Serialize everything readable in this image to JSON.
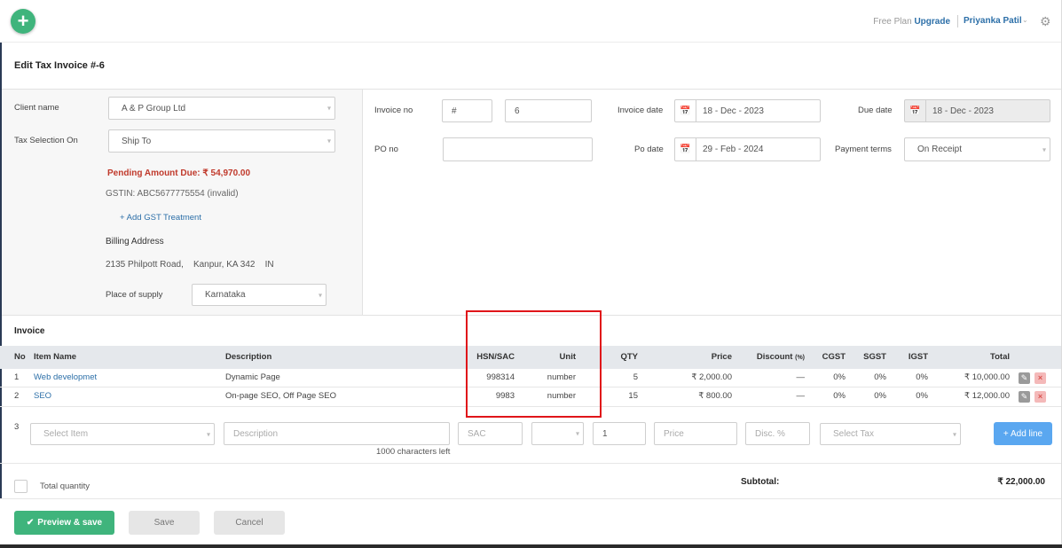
{
  "header": {
    "free_plan": "Free Plan",
    "upgrade": "Upgrade",
    "user_name": "Priyanka Patil"
  },
  "page_title": "Edit Tax Invoice #-6",
  "client": {
    "client_name_label": "Client name",
    "client_name_value": "A & P Group Ltd",
    "tax_selection_label": "Tax Selection On",
    "tax_selection_value": "Ship To",
    "pending_amount": "Pending Amount Due: ₹ 54,970.00",
    "gstin": "GSTIN: ABC5677775554 (invalid)",
    "add_gst": "Add GST Treatment",
    "billing_heading": "Billing Address",
    "billing_address": "2135 Philpott Road,    Kanpur, KA 342    IN",
    "place_of_supply_label": "Place of supply",
    "place_of_supply_value": "Karnataka"
  },
  "invoice_meta": {
    "invoice_no_label": "Invoice no",
    "invoice_prefix": "#",
    "invoice_no": "6",
    "invoice_date_label": "Invoice date",
    "invoice_date": "18 - Dec - 2023",
    "due_date_label": "Due date",
    "due_date": "18 - Dec - 2023",
    "po_no_label": "PO no",
    "po_no": "",
    "po_date_label": "Po date",
    "po_date": "29 - Feb - 2024",
    "payment_terms_label": "Payment terms",
    "payment_terms": "On Receipt"
  },
  "items_section": {
    "heading": "Invoice",
    "columns": {
      "no": "No",
      "item_name": "Item Name",
      "description": "Description",
      "hsn": "HSN/SAC",
      "unit": "Unit",
      "qty": "QTY",
      "price": "Price",
      "discount": "Discount",
      "discount_unit": "(%)",
      "cgst": "CGST",
      "sgst": "SGST",
      "igst": "IGST",
      "total": "Total"
    },
    "rows": [
      {
        "no": "1",
        "item_name": "Web developmet",
        "description": "Dynamic Page",
        "hsn": "998314",
        "unit": "number",
        "qty": "5",
        "price": "₹ 2,000.00",
        "discount": "—",
        "cgst": "0%",
        "sgst": "0%",
        "igst": "0%",
        "total": "₹ 10,000.00"
      },
      {
        "no": "2",
        "item_name": "SEO",
        "description": "On-page SEO, Off Page SEO",
        "hsn": "9983",
        "unit": "number",
        "qty": "15",
        "price": "₹ 800.00",
        "discount": "—",
        "cgst": "0%",
        "sgst": "0%",
        "igst": "0%",
        "total": "₹ 12,000.00"
      }
    ],
    "new_row": {
      "no": "3",
      "item_placeholder": "Select Item",
      "description_placeholder": "Description",
      "chars_left": "1000 characters left",
      "sac_placeholder": "SAC",
      "qty_value": "1",
      "price_placeholder": "Price",
      "disc_placeholder": "Disc. %",
      "tax_placeholder": "Select Tax",
      "add_line": "+ Add line"
    }
  },
  "summary": {
    "total_quantity_label": "Total quantity",
    "subtotal_label": "Subtotal:",
    "subtotal_value": "₹ 22,000.00"
  },
  "footer": {
    "preview_save": "Preview & save",
    "save": "Save",
    "cancel": "Cancel"
  }
}
